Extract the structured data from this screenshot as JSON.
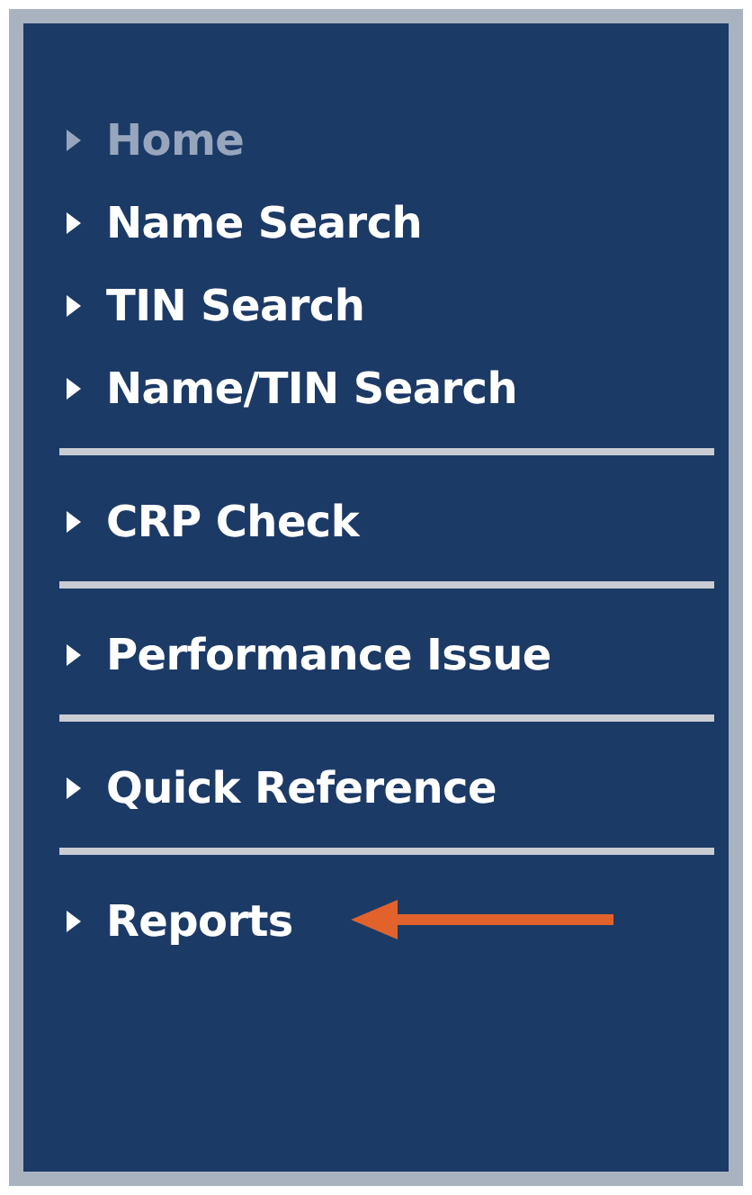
{
  "menu_groups": [
    {
      "items": [
        {
          "label": "Home",
          "selected": true
        },
        {
          "label": "Name Search",
          "selected": false
        },
        {
          "label": "TIN Search",
          "selected": false
        },
        {
          "label": "Name/TIN Search",
          "selected": false
        }
      ]
    },
    {
      "items": [
        {
          "label": "CRP Check",
          "selected": false
        }
      ]
    },
    {
      "items": [
        {
          "label": "Performance Issue",
          "selected": false
        }
      ]
    },
    {
      "items": [
        {
          "label": "Quick Reference",
          "selected": false
        }
      ]
    },
    {
      "items": [
        {
          "label": "Reports",
          "selected": false,
          "annotated": true
        }
      ]
    }
  ]
}
